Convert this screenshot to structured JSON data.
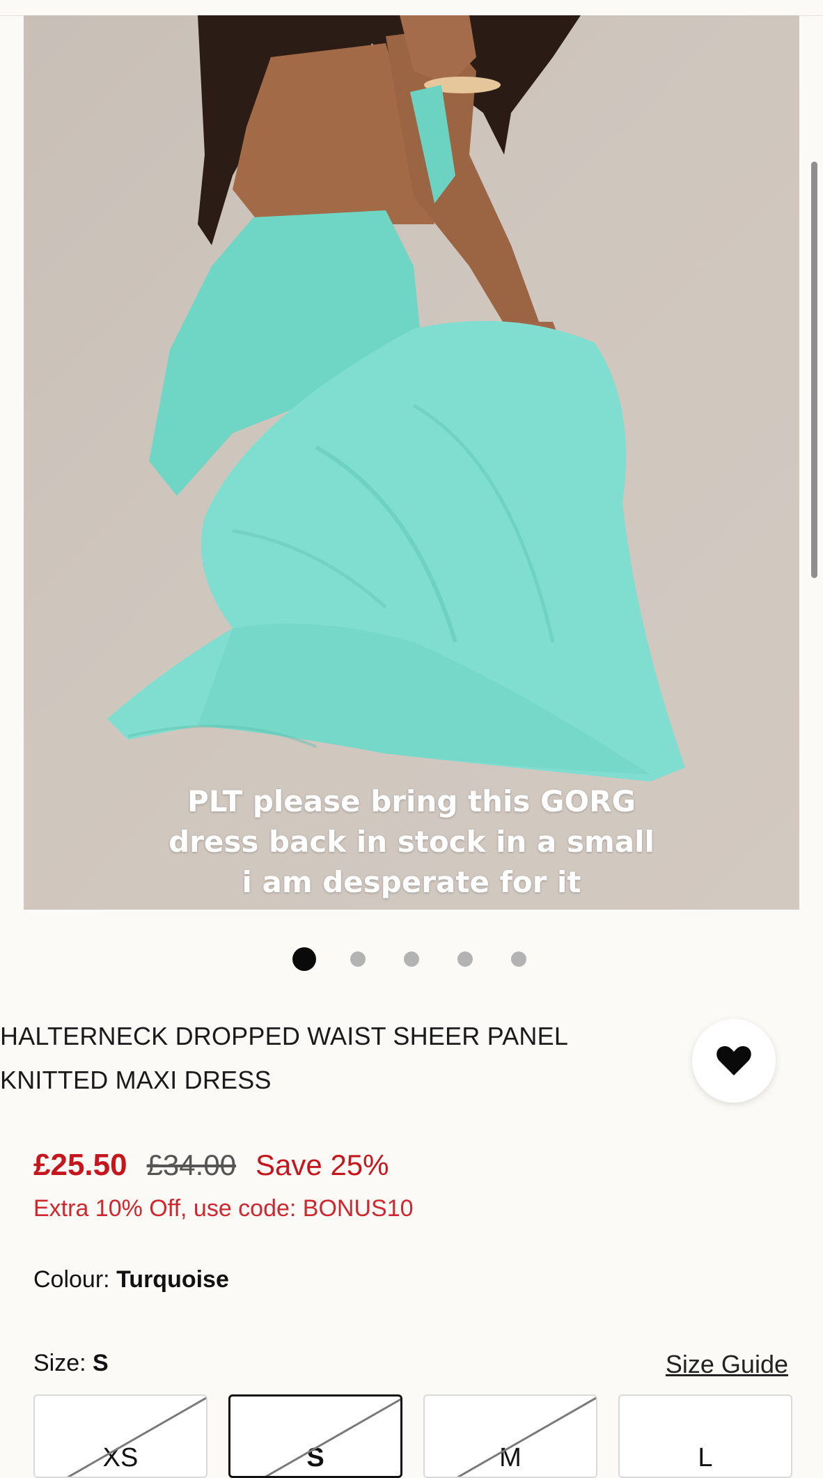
{
  "caption": {
    "line1": "PLT please bring this GORG",
    "line2": "dress back in stock in a small",
    "line3": "i am desperate for it"
  },
  "gallery": {
    "total": 5,
    "active_index": 0
  },
  "product": {
    "title_line1": "HALTERNECK DROPPED WAIST SHEER PANEL",
    "title_line2": "KNITTED MAXI DRESS",
    "favourite_icon": "heart-icon"
  },
  "price": {
    "current": "£25.50",
    "original": "£34.00",
    "save": "Save 25%",
    "promo": "Extra 10% Off, use code: BONUS10"
  },
  "colour": {
    "label": "Colour: ",
    "value": "Turquoise"
  },
  "size": {
    "label": "Size: ",
    "value": "S",
    "guide_label": "Size Guide",
    "options": [
      {
        "label": "XS",
        "out_of_stock": true,
        "selected": false
      },
      {
        "label": "S",
        "out_of_stock": true,
        "selected": true
      },
      {
        "label": "M",
        "out_of_stock": true,
        "selected": false
      },
      {
        "label": "L",
        "out_of_stock": false,
        "selected": false
      }
    ]
  },
  "colors": {
    "sale_red": "#c5161d",
    "dress_turquoise": "#74dccb",
    "background": "#fbfaf6"
  }
}
